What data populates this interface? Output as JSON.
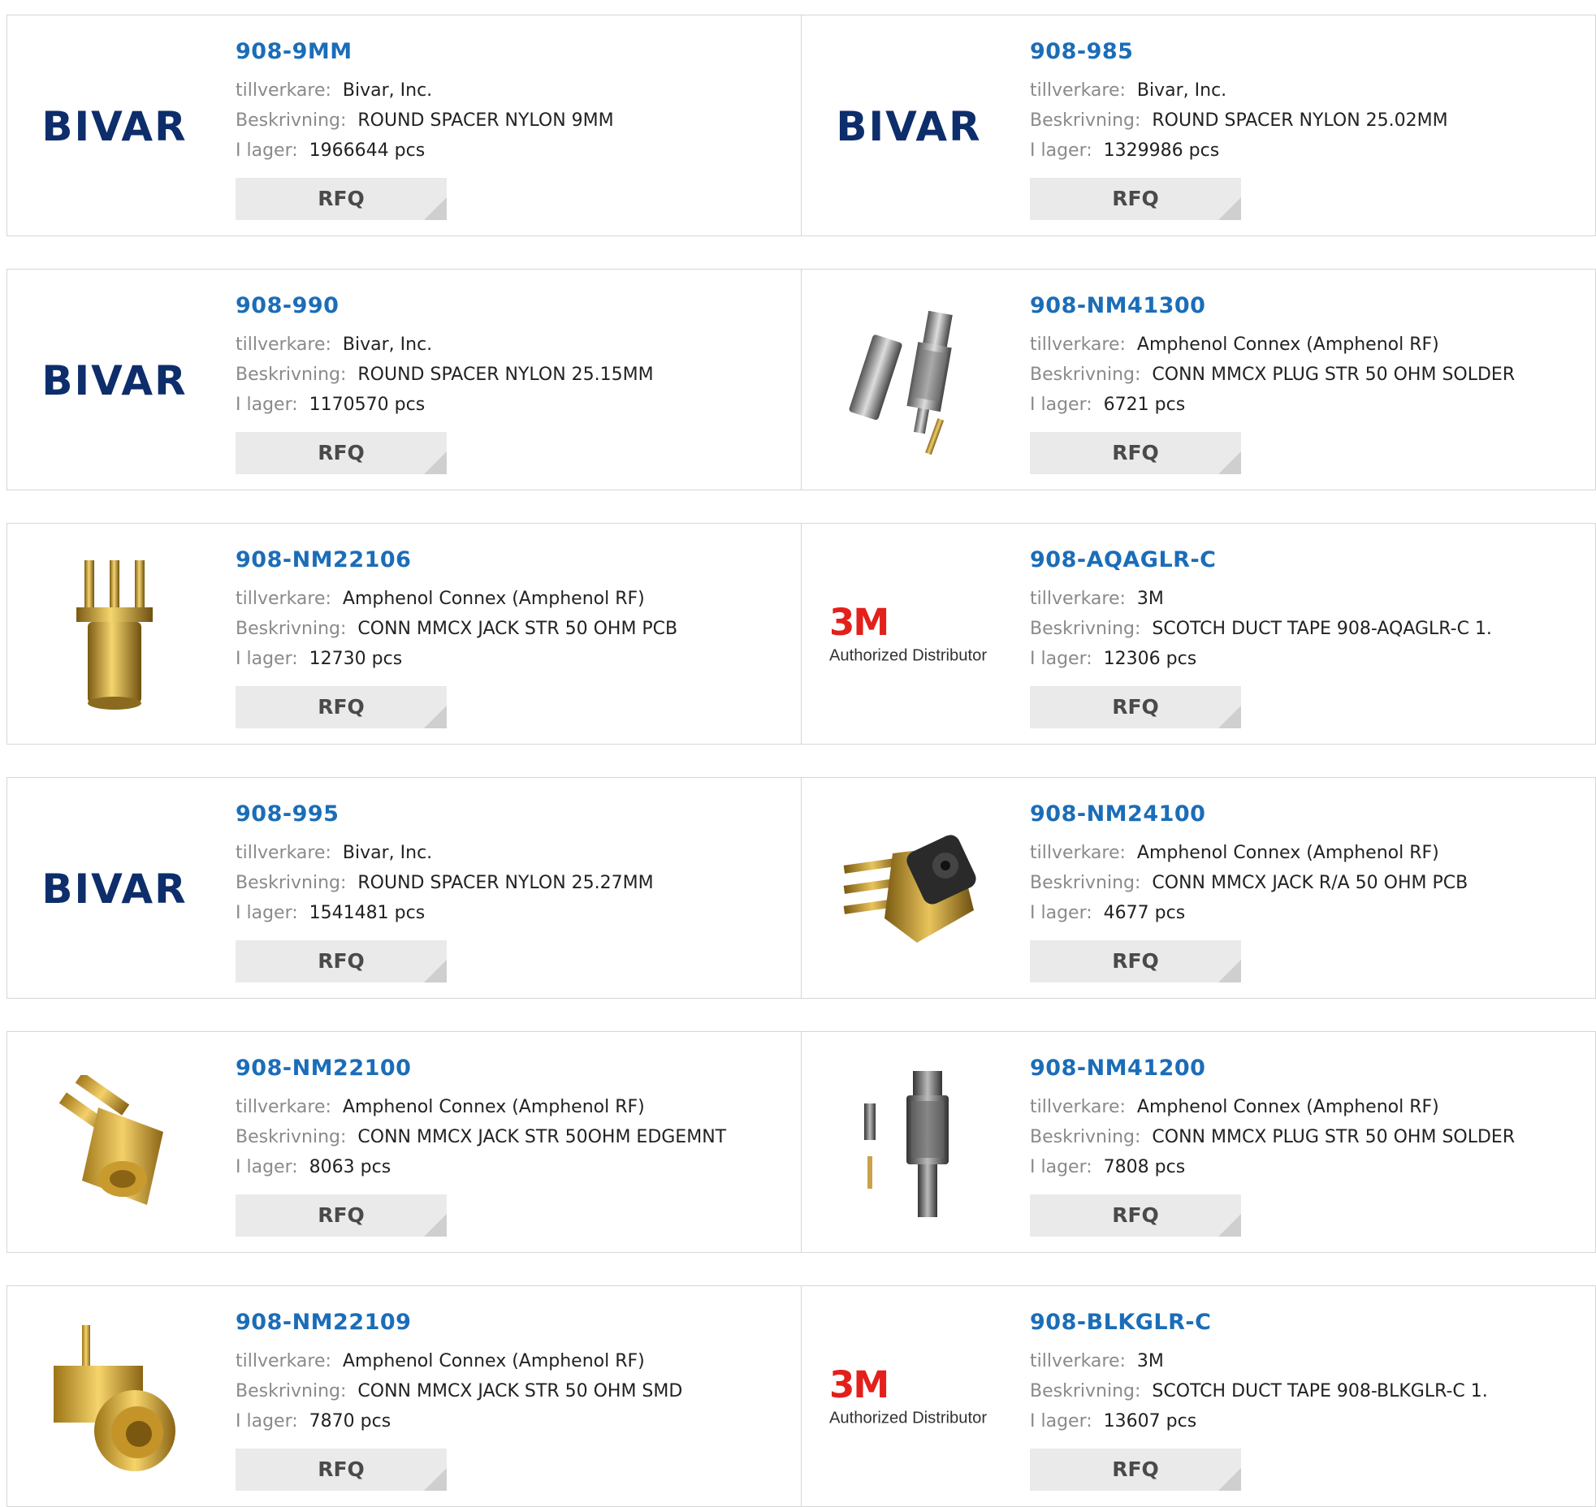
{
  "labels": {
    "manufacturer": "tillverkare:",
    "description": "Beskrivning:",
    "stock": "I lager:",
    "rfq": "RFQ"
  },
  "brand_logos": {
    "bivar": "BIVAR",
    "threem": "3M",
    "threem_sub": "Authorized Distributor"
  },
  "colors": {
    "part_link": "#1b6db8",
    "bivar_blue": "#0d2d6b",
    "threem_red": "#e3201b",
    "rfq_bg": "#eaeaea"
  },
  "products": [
    {
      "part": "908-9MM",
      "manufacturer": "Bivar, Inc.",
      "description": "ROUND SPACER NYLON 9MM",
      "stock": "1966644 pcs",
      "image": "bivar-logo"
    },
    {
      "part": "908-985",
      "manufacturer": "Bivar, Inc.",
      "description": "ROUND SPACER NYLON 25.02MM",
      "stock": "1329986 pcs",
      "image": "bivar-logo"
    },
    {
      "part": "908-990",
      "manufacturer": "Bivar, Inc.",
      "description": "ROUND SPACER NYLON 25.15MM",
      "stock": "1170570 pcs",
      "image": "bivar-logo"
    },
    {
      "part": "908-NM41300",
      "manufacturer": "Amphenol Connex (Amphenol RF)",
      "description": "CONN MMCX PLUG STR 50 OHM SOLDER",
      "stock": "6721 pcs",
      "image": "mmcx-plug-kit-photo"
    },
    {
      "part": "908-NM22106",
      "manufacturer": "Amphenol Connex (Amphenol RF)",
      "description": "CONN MMCX JACK STR 50 OHM PCB",
      "stock": "12730 pcs",
      "image": "mmcx-jack-pcb-photo"
    },
    {
      "part": "908-AQAGLR-C",
      "manufacturer": "3M",
      "description": "SCOTCH DUCT TAPE 908-AQAGLR-C 1.",
      "stock": "12306 pcs",
      "image": "3m-logo"
    },
    {
      "part": "908-995",
      "manufacturer": "Bivar, Inc.",
      "description": "ROUND SPACER NYLON 25.27MM",
      "stock": "1541481 pcs",
      "image": "bivar-logo"
    },
    {
      "part": "908-NM24100",
      "manufacturer": "Amphenol Connex (Amphenol RF)",
      "description": "CONN MMCX JACK R/A 50 OHM PCB",
      "stock": "4677 pcs",
      "image": "mmcx-jack-ra-photo"
    },
    {
      "part": "908-NM22100",
      "manufacturer": "Amphenol Connex (Amphenol RF)",
      "description": "CONN MMCX JACK STR 50OHM EDGEMNT",
      "stock": "8063 pcs",
      "image": "mmcx-jack-edge-photo"
    },
    {
      "part": "908-NM41200",
      "manufacturer": "Amphenol Connex (Amphenol RF)",
      "description": "CONN MMCX PLUG STR 50 OHM SOLDER",
      "stock": "7808 pcs",
      "image": "mmcx-plug-photo"
    },
    {
      "part": "908-NM22109",
      "manufacturer": "Amphenol Connex (Amphenol RF)",
      "description": "CONN MMCX JACK STR 50 OHM SMD",
      "stock": "7870 pcs",
      "image": "mmcx-jack-smd-photo"
    },
    {
      "part": "908-BLKGLR-C",
      "manufacturer": "3M",
      "description": "SCOTCH DUCT TAPE 908-BLKGLR-C 1.",
      "stock": "13607 pcs",
      "image": "3m-logo"
    }
  ]
}
